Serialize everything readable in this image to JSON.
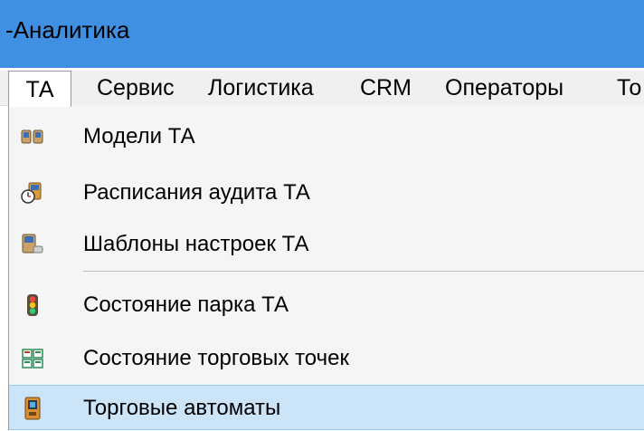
{
  "window": {
    "title": "-Аналитика"
  },
  "menubar": {
    "items": [
      {
        "label": "ТА"
      },
      {
        "label": "Сервис"
      },
      {
        "label": "Логистика"
      },
      {
        "label": "CRM"
      },
      {
        "label": "Операторы"
      },
      {
        "label": "То"
      }
    ],
    "active_item": "ТА"
  },
  "dropdown": {
    "items": [
      {
        "label": "Модели ТА",
        "icon": "machine-models-icon"
      },
      {
        "label": "Расписания аудита ТА",
        "icon": "audit-schedule-icon"
      },
      {
        "label": "Шаблоны настроек ТА",
        "icon": "settings-template-icon"
      },
      {
        "label": "Состояние парка ТА",
        "icon": "traffic-light-icon"
      },
      {
        "label": "Состояние торговых точек",
        "icon": "grid-status-icon"
      },
      {
        "label": "Торговые автоматы",
        "icon": "vending-machine-icon"
      }
    ],
    "selected_index": 5
  },
  "colors": {
    "titlebar": "#3f8fe3",
    "menubar": "#f0f0f0",
    "dropdown_bg": "#f5f5f5",
    "selection": "#cce4f7",
    "selection_border": "#99c9ef"
  }
}
